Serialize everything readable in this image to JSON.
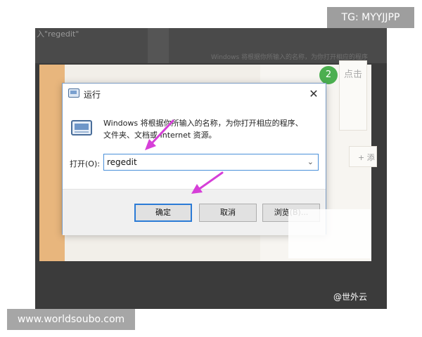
{
  "watermarks": {
    "tg": "TG: MYYJJPP",
    "site": "www.worldsoubo.com",
    "credit": "@世外云"
  },
  "background": {
    "top_text": "入\"regedit\"",
    "sub_text": "Windows 将根据你所输入的名称，为你打开相应的程序",
    "badge": "2",
    "card_text": "点击",
    "side_btn": "+ 添"
  },
  "dialog": {
    "title": "运行",
    "close": "✕",
    "description_line1": "Windows 将根据你所输入的名称，为你打开相应的程序、",
    "description_line2": "文件夹、文档或 Internet 资源。",
    "open_label": "打开(O):",
    "open_value": "regedit",
    "ok_label": "确定",
    "cancel_label": "取消",
    "browse_label": "浏览(B)..."
  },
  "colors": {
    "accent": "#2b7bd6",
    "arrow": "#d63fd8",
    "badge": "#4caf50",
    "orange": "#e8b67d"
  },
  "icons": [
    "run-app-icon",
    "close-icon",
    "chevron-down-icon",
    "arrow-annotation-icon"
  ]
}
